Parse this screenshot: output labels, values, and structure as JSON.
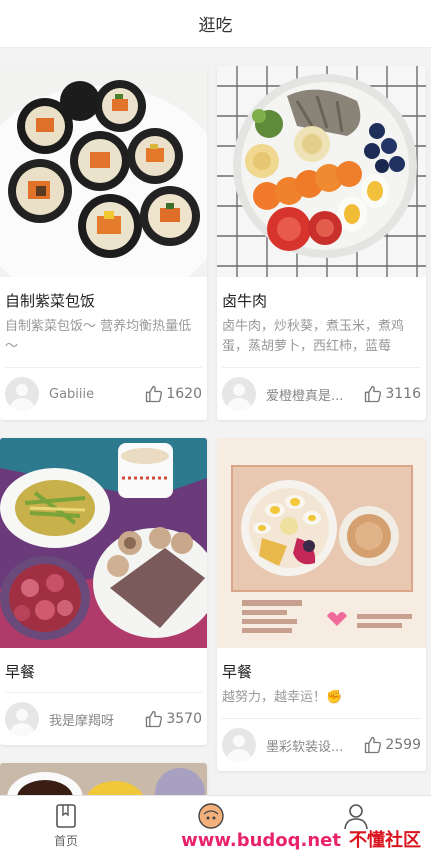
{
  "header": {
    "title": "逛吃"
  },
  "cards": [
    {
      "name": "自制紫菜包饭",
      "desc": "自制紫菜包饭～ 营养均衡热量低～",
      "author": "Gabiiie",
      "likes": "1620"
    },
    {
      "name": "卤牛肉",
      "desc": "卤牛肉，炒秋葵，煮玉米，煮鸡蛋，蒸胡萝卜，西红柿，蓝莓",
      "author": "爱橙橙真是...",
      "likes": "3116"
    },
    {
      "name": "早餐",
      "desc": "",
      "author": "我是摩羯呀",
      "likes": "3570"
    },
    {
      "name": "早餐",
      "desc": "越努力，越幸运！✊",
      "author": "墨彩软装设...",
      "likes": "2599"
    }
  ],
  "tabbar": {
    "home_label": "首页"
  },
  "watermark": {
    "url": "www.budoq.net",
    "cn": "不懂社区"
  },
  "colors": {
    "accent": "#e8236c",
    "watermark_cn": "#d9141e",
    "muted": "#999999"
  }
}
